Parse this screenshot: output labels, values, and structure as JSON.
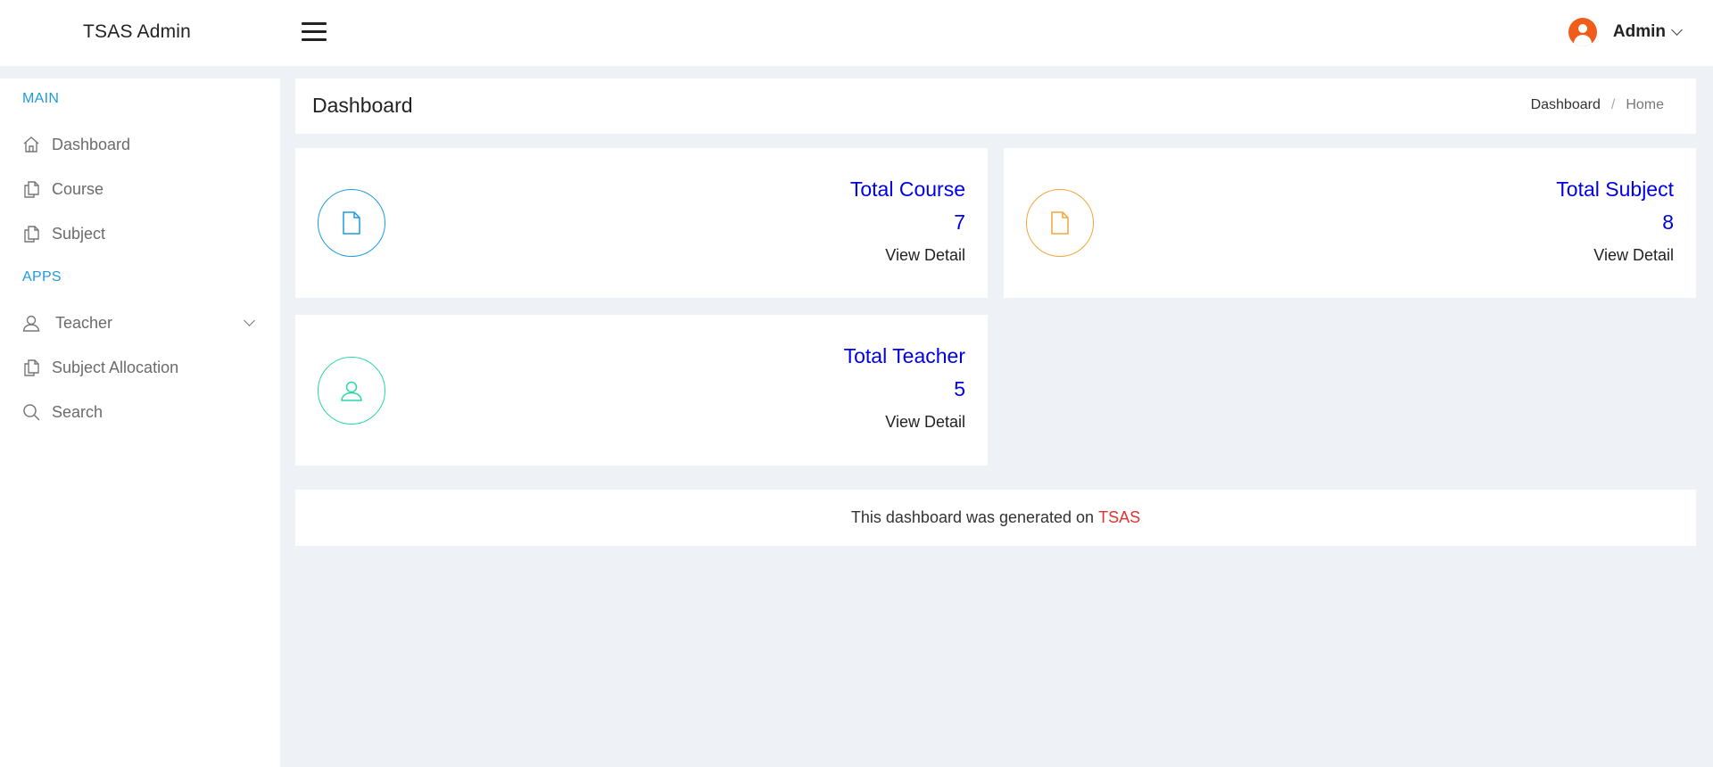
{
  "header": {
    "brand": "TSAS Admin",
    "user_name": "Admin"
  },
  "sidebar": {
    "sections": [
      "MAIN",
      "APPS"
    ],
    "items": [
      {
        "label": "Dashboard",
        "icon": "home-icon"
      },
      {
        "label": "Course",
        "icon": "copy-icon"
      },
      {
        "label": "Subject",
        "icon": "copy-icon"
      },
      {
        "label": "Teacher",
        "icon": "user-icon"
      },
      {
        "label": "Subject Allocation",
        "icon": "copy-icon"
      },
      {
        "label": "Search",
        "icon": "search-icon"
      }
    ]
  },
  "page": {
    "title": "Dashboard",
    "breadcrumb": [
      "Dashboard",
      "Home"
    ]
  },
  "cards": [
    {
      "title": "Total Course",
      "value": "7",
      "link": "View Detail",
      "icon": "file-icon",
      "color": "#1e9be0"
    },
    {
      "title": "Total Subject",
      "value": "8",
      "link": "View Detail",
      "icon": "file-icon",
      "color": "#f0a63a"
    },
    {
      "title": "Total Teacher",
      "value": "5",
      "link": "View Detail",
      "icon": "user-icon",
      "color": "#2ad6a8"
    }
  ],
  "footer": {
    "text": "This dashboard was generated on",
    "link": "TSAS",
    "link_color": "#e0322e"
  }
}
